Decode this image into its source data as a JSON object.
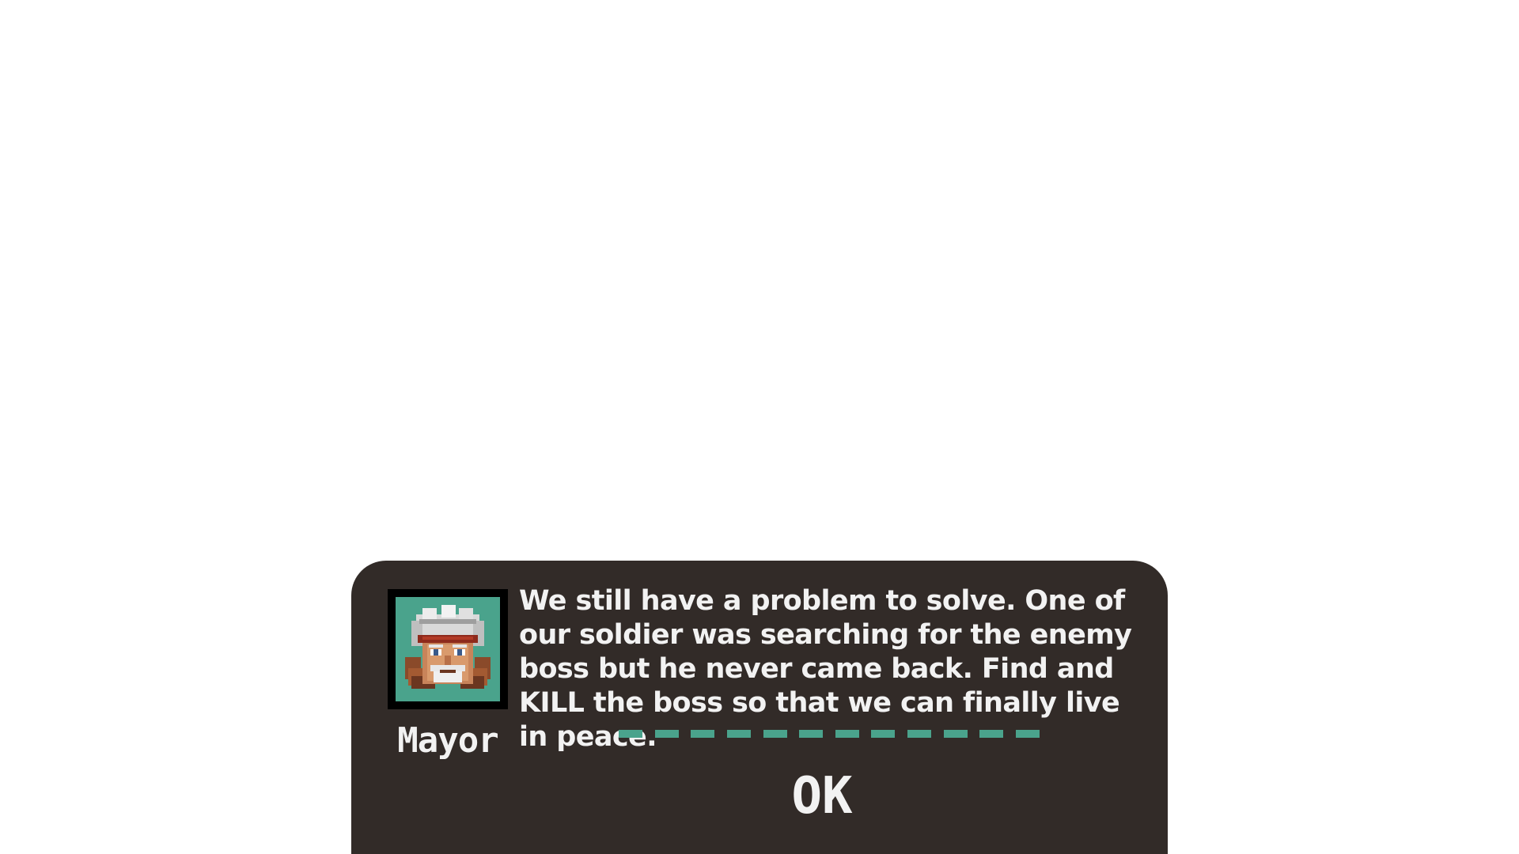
{
  "dialog": {
    "speaker": {
      "name": "Mayor",
      "portrait_icon": "mayor-portrait"
    },
    "message": "We still have a problem to solve. One of our soldier was searching for the enemy boss but he never came back. Find and KILL the boss so that we can finally live in peace.",
    "confirm_label": "OK"
  },
  "colors": {
    "page_background": "#ffffff",
    "dialog_background": "#322b28",
    "portrait_background": "#4aa38c",
    "divider": "#4aa38c",
    "text": "#f2f2f2"
  }
}
